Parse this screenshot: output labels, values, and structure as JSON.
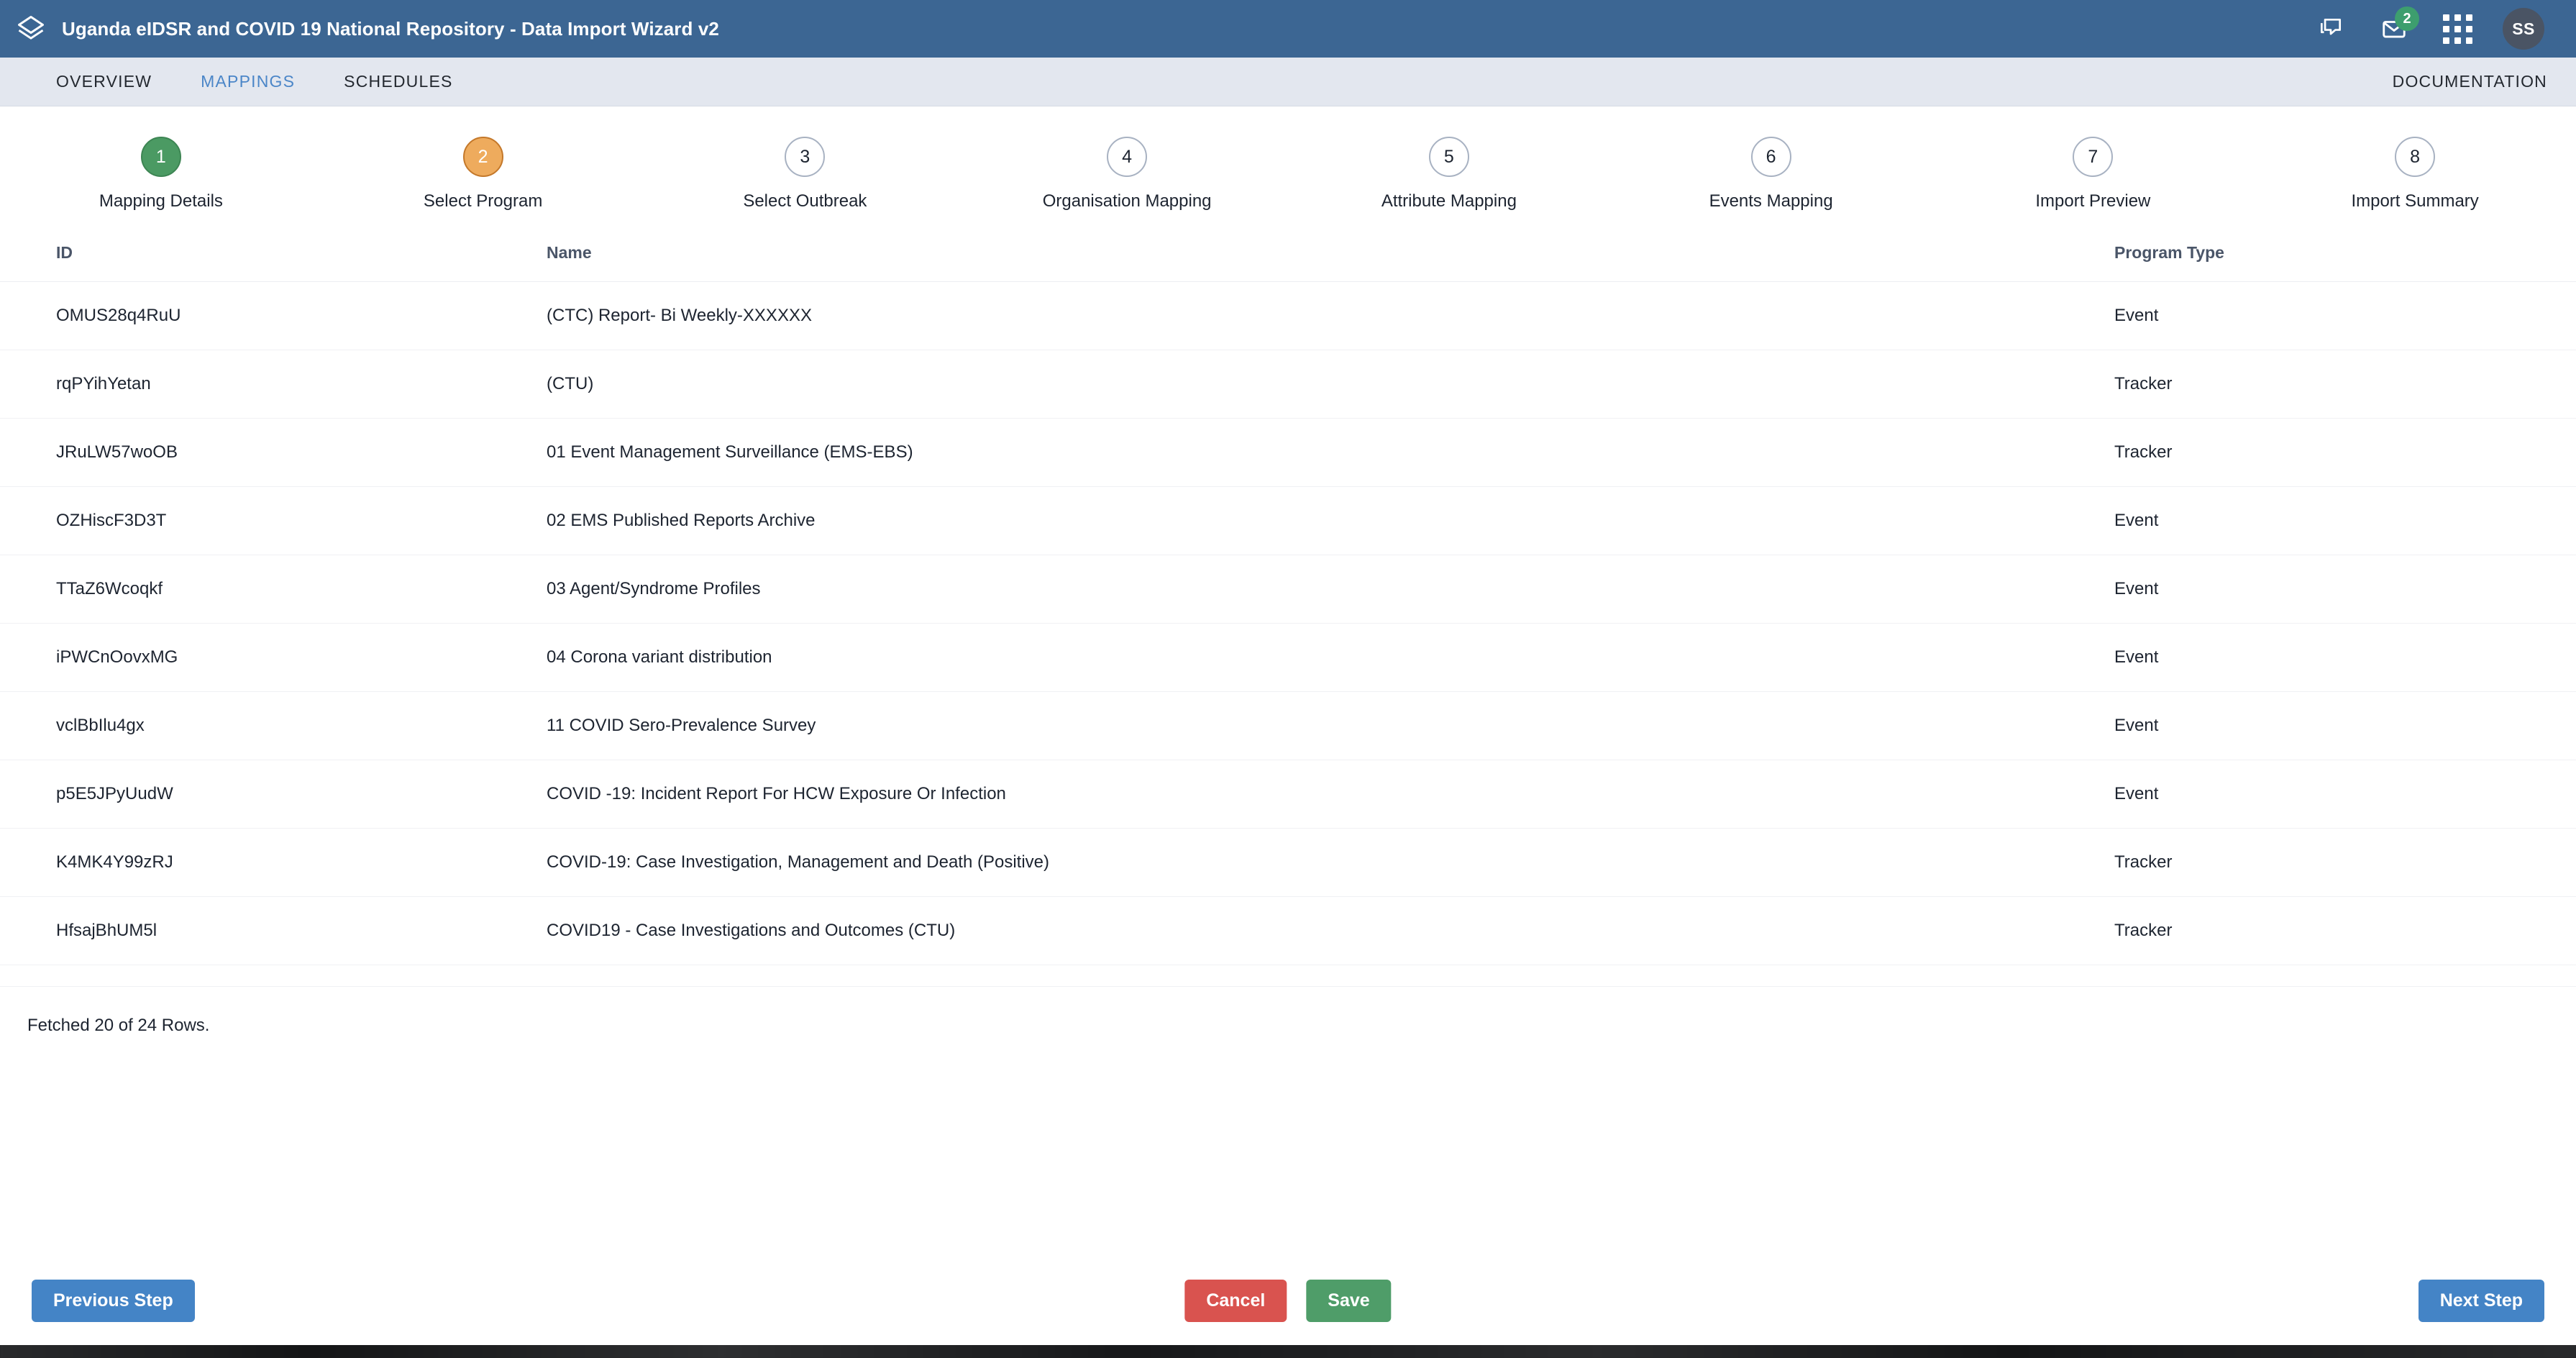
{
  "header": {
    "logo_icon": "layers-icon",
    "title": "Uganda eIDSR and COVID 19 National Repository - Data Import Wizard v2",
    "brand_color": "#3c6693",
    "icons": {
      "messages": "chat-bubble-icon",
      "mail": "envelope-icon",
      "mail_badge": "2",
      "apps": "apps-grid-icon"
    },
    "avatar_initials": "SS"
  },
  "nav": {
    "tabs": [
      {
        "label": "OVERVIEW",
        "active": false
      },
      {
        "label": "MAPPINGS",
        "active": true
      },
      {
        "label": "SCHEDULES",
        "active": false
      }
    ],
    "documentation_label": "DOCUMENTATION",
    "active_color": "#4b86c8"
  },
  "stepper": {
    "steps": [
      {
        "number": "1",
        "label": "Mapping Details",
        "state": "done"
      },
      {
        "number": "2",
        "label": "Select Program",
        "state": "active"
      },
      {
        "number": "3",
        "label": "Select Outbreak",
        "state": "idle"
      },
      {
        "number": "4",
        "label": "Organisation Mapping",
        "state": "idle"
      },
      {
        "number": "5",
        "label": "Attribute Mapping",
        "state": "idle"
      },
      {
        "number": "6",
        "label": "Events Mapping",
        "state": "idle"
      },
      {
        "number": "7",
        "label": "Import Preview",
        "state": "idle"
      },
      {
        "number": "8",
        "label": "Import Summary",
        "state": "idle"
      }
    ],
    "done_color": "#4b9a63",
    "active_color": "#eeab5d"
  },
  "table": {
    "columns": [
      "ID",
      "Name",
      "Program Type"
    ],
    "rows": [
      {
        "id": "OMUS28q4RuU",
        "name": "(CTC) Report- Bi Weekly-XXXXXX",
        "type": "Event"
      },
      {
        "id": "rqPYihYetan",
        "name": "(CTU)",
        "type": "Tracker"
      },
      {
        "id": "JRuLW57woOB",
        "name": "01 Event Management Surveillance (EMS-EBS)",
        "type": "Tracker"
      },
      {
        "id": "OZHiscF3D3T",
        "name": "02 EMS Published Reports Archive",
        "type": "Event"
      },
      {
        "id": "TTaZ6Wcoqkf",
        "name": "03 Agent/Syndrome Profiles",
        "type": "Event"
      },
      {
        "id": "iPWCnOovxMG",
        "name": "04 Corona variant distribution",
        "type": "Event"
      },
      {
        "id": "vclBbIlu4gx",
        "name": "11 COVID Sero-Prevalence Survey",
        "type": "Event"
      },
      {
        "id": "p5E5JPyUudW",
        "name": "COVID -19: Incident Report For HCW Exposure Or Infection",
        "type": "Event"
      },
      {
        "id": "K4MK4Y99zRJ",
        "name": "COVID-19: Case Investigation, Management and Death (Positive)",
        "type": "Tracker"
      },
      {
        "id": "HfsajBhUM5l",
        "name": "COVID19 - Case Investigations and Outcomes (CTU)",
        "type": "Tracker"
      }
    ],
    "fetched_text": "Fetched 20 of 24 Rows."
  },
  "footer": {
    "previous_label": "Previous Step",
    "cancel_label": "Cancel",
    "save_label": "Save",
    "next_label": "Next Step",
    "blue": "#4484c6",
    "red": "#d9534f",
    "green": "#4f9d69"
  }
}
